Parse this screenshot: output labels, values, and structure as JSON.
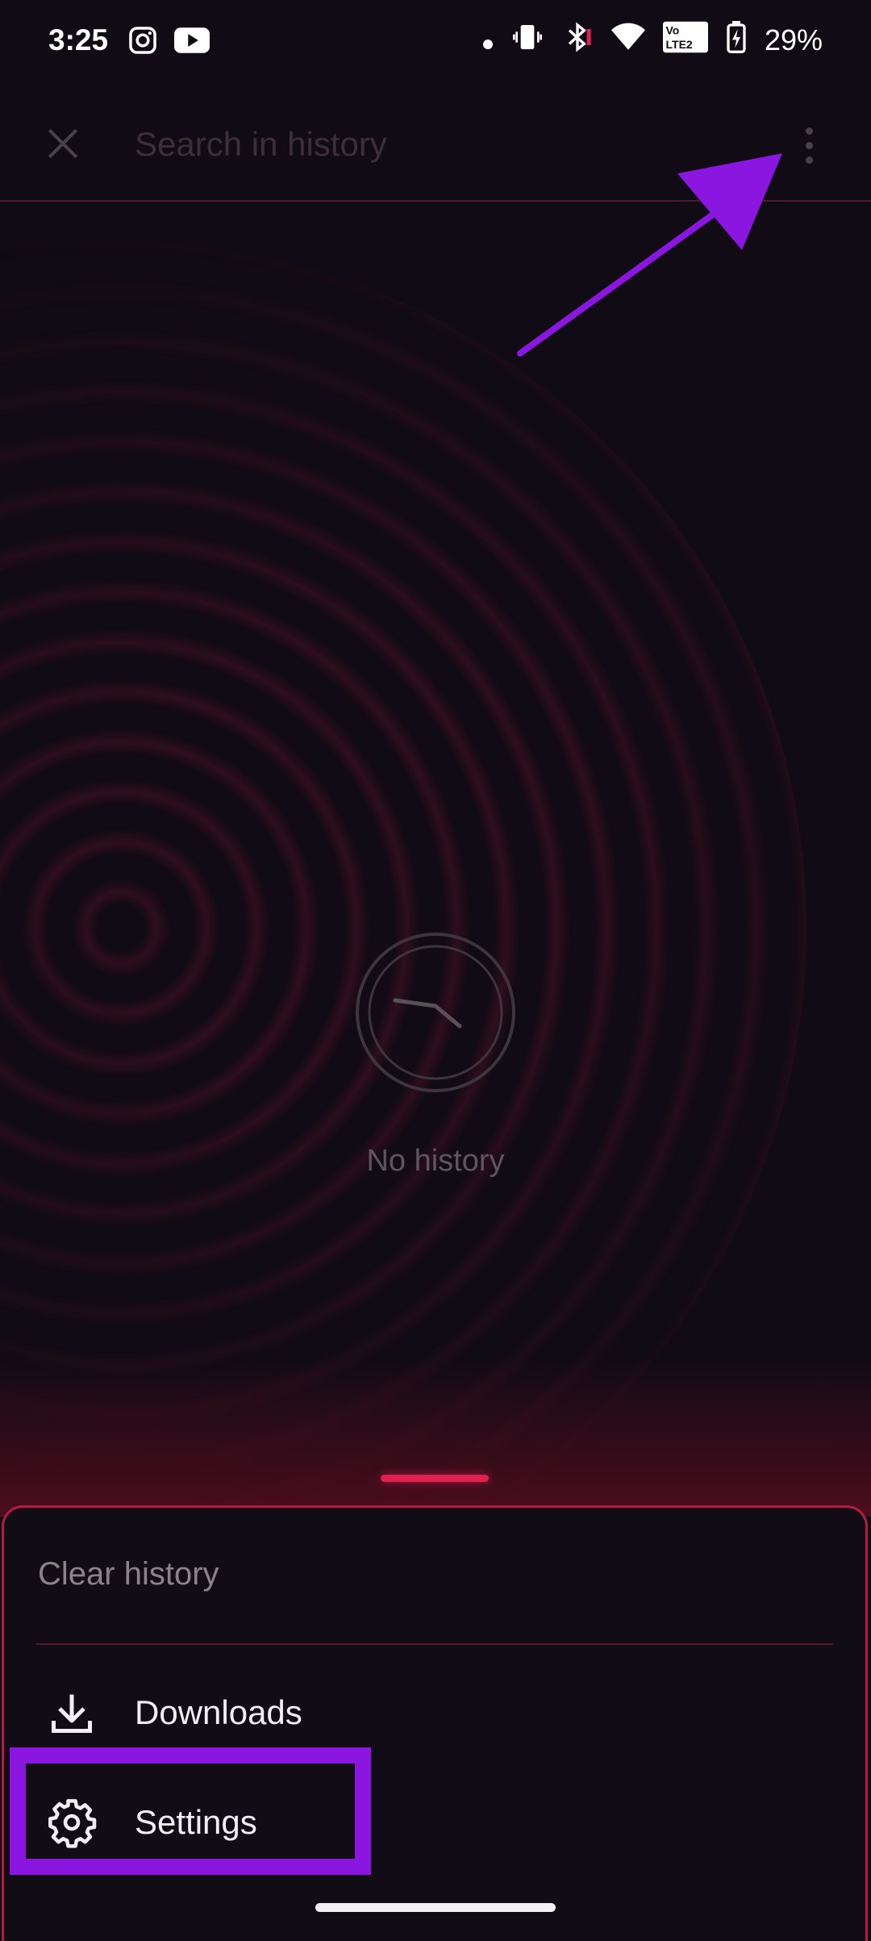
{
  "status_bar": {
    "time": "3:25",
    "battery": "29%",
    "icons": [
      "instagram-icon",
      "youtube-icon",
      "dot-icon",
      "vibrate-icon",
      "bluetooth-icon",
      "wifi-icon",
      "volte-icon",
      "battery-icon"
    ]
  },
  "search": {
    "placeholder": "Search in history"
  },
  "empty_state": {
    "text": "No history"
  },
  "bottom_sheet": {
    "clear_history": "Clear history",
    "downloads": "Downloads",
    "settings": "Settings"
  },
  "colors": {
    "accent": "#e0204f",
    "annotation": "#8a16e0",
    "background": "#100b14"
  }
}
